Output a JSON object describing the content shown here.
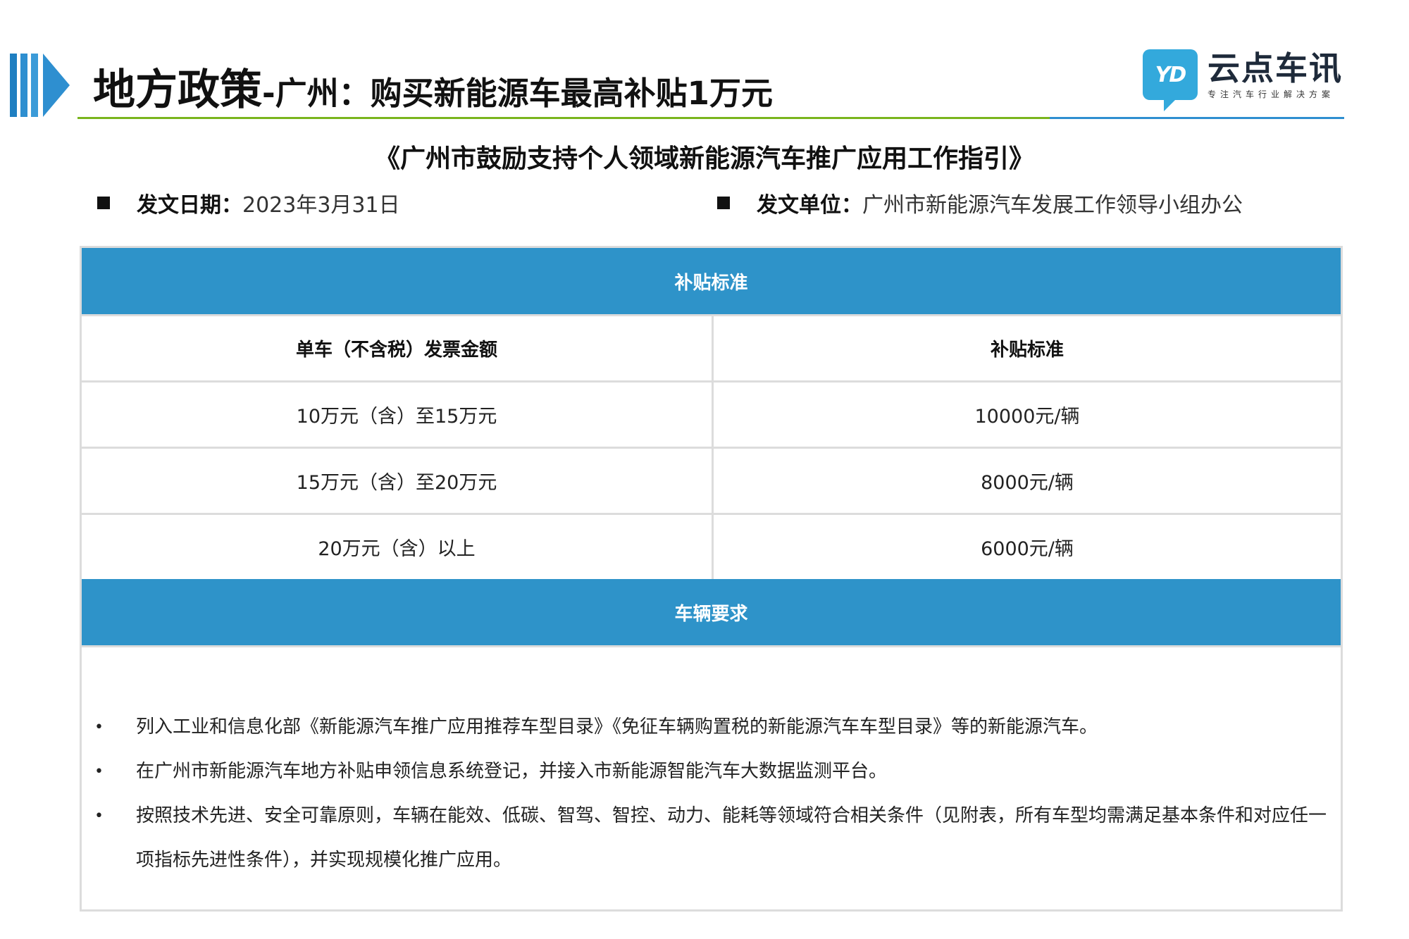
{
  "header": {
    "title_main": "地方政策",
    "title_sub": "-广州：购买新能源车最高补贴1万元"
  },
  "logo": {
    "mark": "YD",
    "name": "云点车讯",
    "tagline": "专注汽车行业解决方案"
  },
  "document": {
    "title": "《广州市鼓励支持个人领域新能源汽车推广应用工作指引》",
    "date_label": "发文日期：",
    "date_value": "2023年3月31日",
    "issuer_label": "发文单位：",
    "issuer_value": "广州市新能源汽车发展工作领导小组办公"
  },
  "subsidy": {
    "section_title": "补贴标准",
    "col1_header": "单车（不含税）发票金额",
    "col2_header": "补贴标准",
    "rows": [
      {
        "range": "10万元（含）至15万元",
        "amount": "10000元/辆"
      },
      {
        "range": "15万元（含）至20万元",
        "amount": "8000元/辆"
      },
      {
        "range": "20万元（含）以上",
        "amount": "6000元/辆"
      }
    ]
  },
  "requirements": {
    "section_title": "车辆要求",
    "items": [
      "列入工业和信息化部《新能源汽车推广应用推荐车型目录》《免征车辆购置税的新能源汽车车型目录》等的新能源汽车。",
      "在广州市新能源汽车地方补贴申领信息系统登记，并接入市新能源智能汽车大数据监测平台。",
      "按照技术先进、安全可靠原则，车辆在能效、低碳、智驾、智控、动力、能耗等领域符合相关条件（见附表，所有车型均需满足基本条件和对应任一项指标先进性条件），并实现规模化推广应用。"
    ]
  },
  "colors": {
    "accent_blue": "#2e93c9",
    "accent_green": "#7ab51d",
    "logo_blue": "#33a9dc"
  }
}
